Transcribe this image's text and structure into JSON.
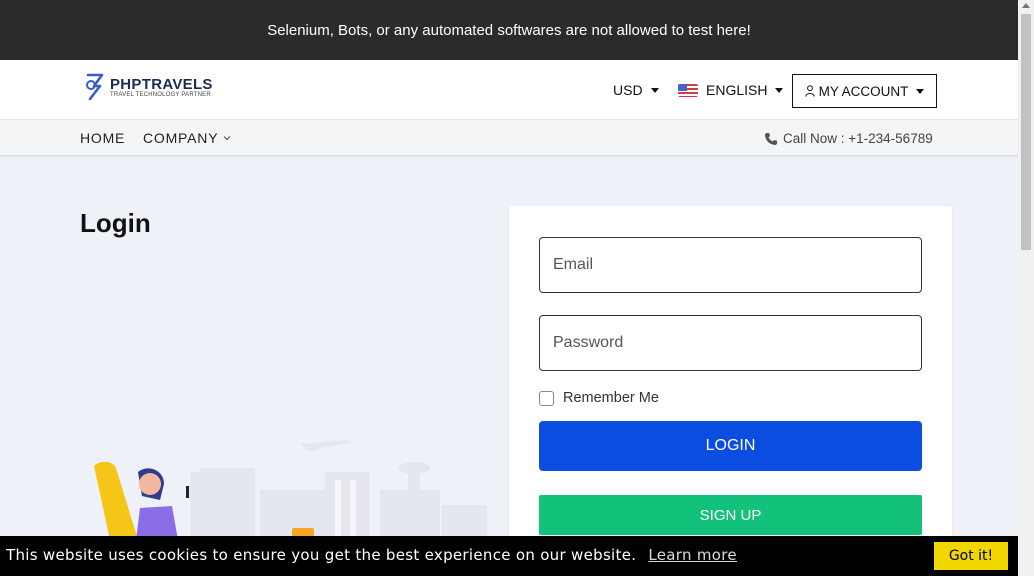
{
  "warning_bar": {
    "text": "Selenium, Bots, or any automated softwares are not allowed to test here!"
  },
  "header": {
    "logo_title": "PHPTRAVELS",
    "logo_subtitle": "TRAVEL TECHNOLOGY PARTNER",
    "currency": "USD",
    "language": "ENGLISH",
    "account_label": "MY ACCOUNT"
  },
  "nav": {
    "home": "HOME",
    "company": "COMPANY",
    "call": "Call Now : +1-234-56789"
  },
  "main": {
    "title": "Login"
  },
  "login_form": {
    "email_placeholder": "Email",
    "email_value": "",
    "password_placeholder": "Password",
    "password_value": "",
    "remember_label": "Remember Me",
    "remember_checked": false,
    "login_label": "LOGIN",
    "signup_label": "SIGN UP"
  },
  "cookie_bar": {
    "text": "This website uses cookies to ensure you get the best experience on our website.",
    "link": "Learn more",
    "button": "Got it!"
  },
  "icons": {
    "logo": "logo-icon",
    "user": "user-icon",
    "phone": "phone-icon",
    "flag": "us-flag-icon",
    "chevron": "chevron-down-icon"
  },
  "colors": {
    "warning_bg": "#2b2b2b",
    "login_button": "#0a4de0",
    "signup_button": "#13c27a",
    "cookie_button": "#f1d600",
    "page_bg": "#eef1f8"
  }
}
